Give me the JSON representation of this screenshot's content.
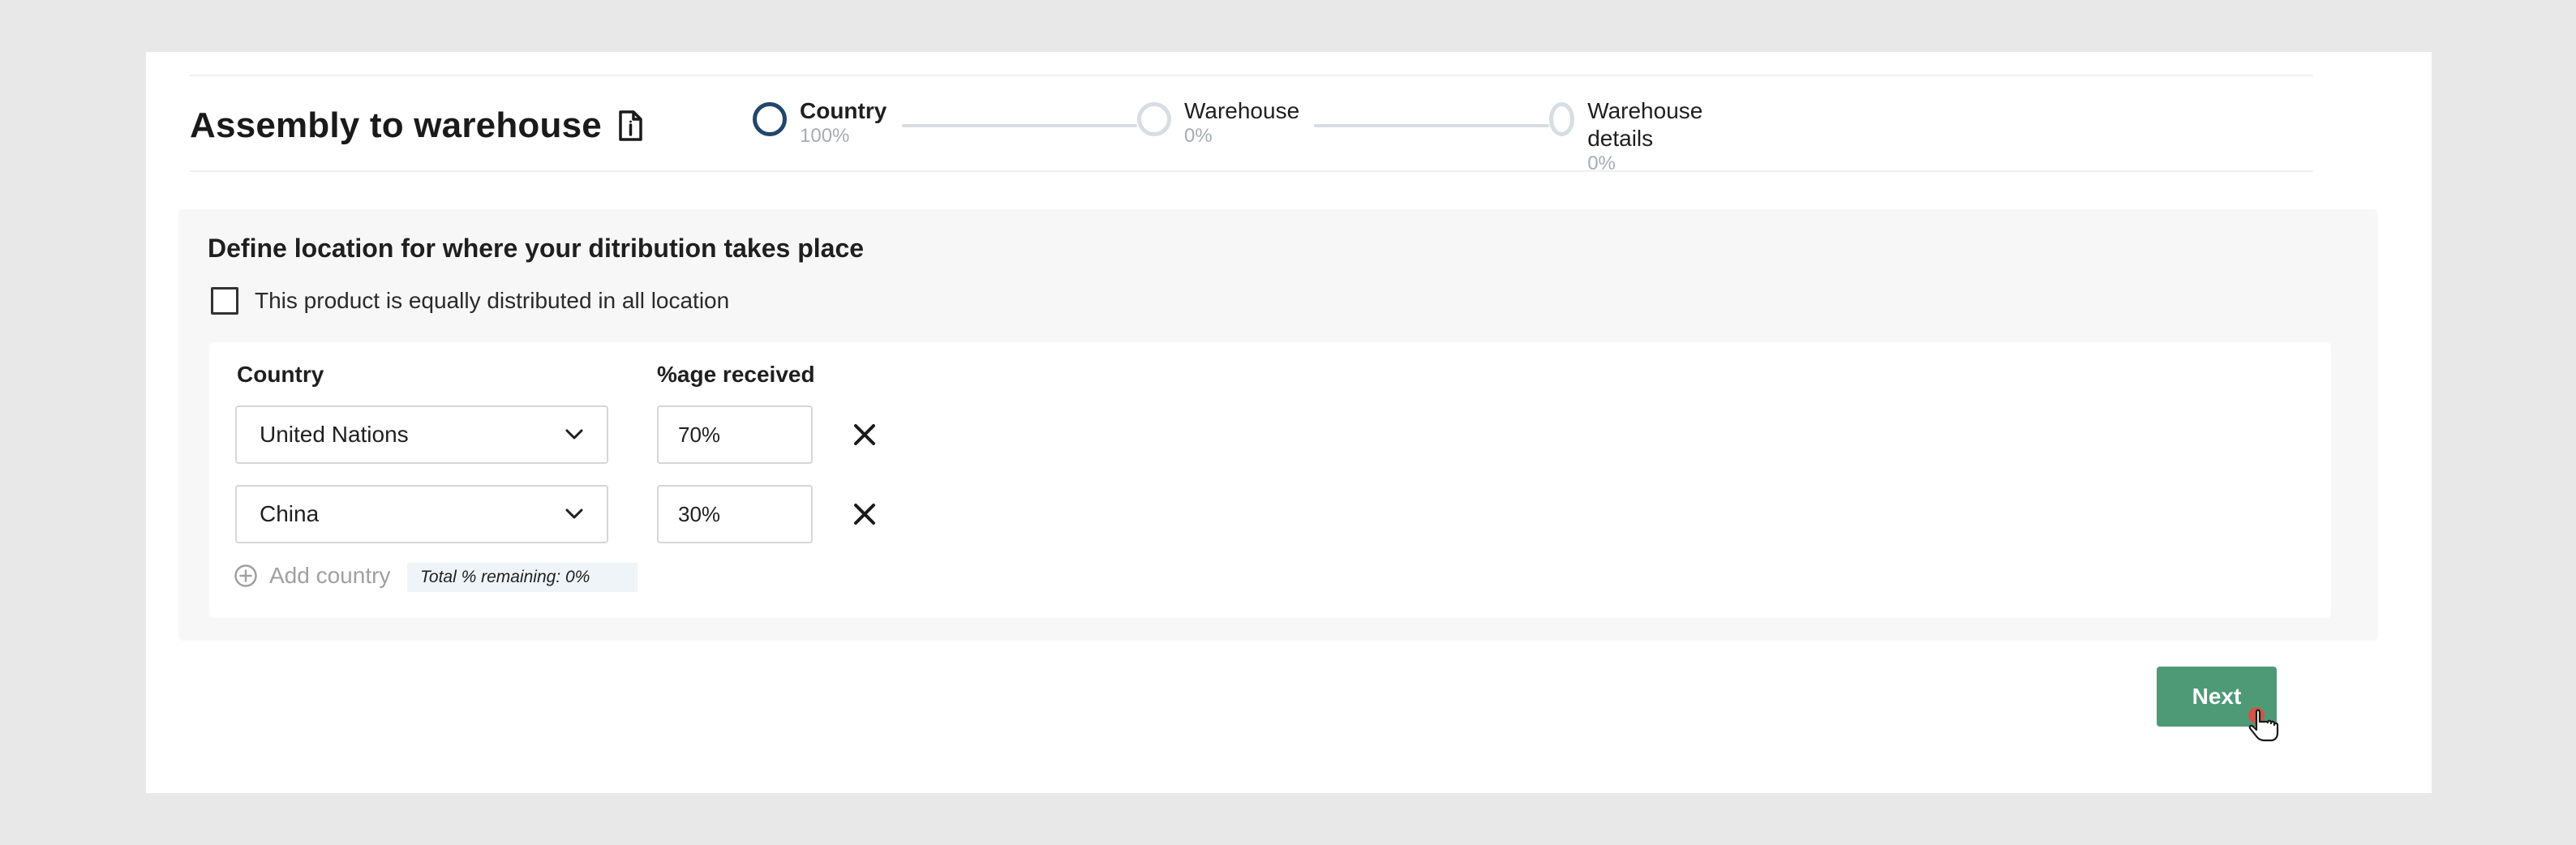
{
  "header": {
    "title": "Assembly to warehouse",
    "title_icon": "document-info-icon"
  },
  "stepper": {
    "steps": [
      {
        "label": "Country",
        "percent": "100%",
        "active": true
      },
      {
        "label": "Warehouse",
        "percent": "0%",
        "active": false
      },
      {
        "label": "Warehouse details",
        "percent": "0%",
        "active": false
      }
    ]
  },
  "panel": {
    "heading": "Define location for where your ditribution takes place",
    "checkbox_label": "This product is equally distributed in all location",
    "checkbox_checked": false,
    "columns": {
      "country": "Country",
      "percentage": "%age received"
    },
    "rows": [
      {
        "country": "United Nations",
        "percentage": "70%"
      },
      {
        "country": "China",
        "percentage": "30%"
      }
    ],
    "add_country_label": "Add country",
    "remaining_label": "Total % remaining: 0%"
  },
  "actions": {
    "next_label": "Next"
  },
  "colors": {
    "accent_green": "#4f9a76",
    "step_active": "#22466b",
    "step_inactive": "#d6dde3"
  }
}
